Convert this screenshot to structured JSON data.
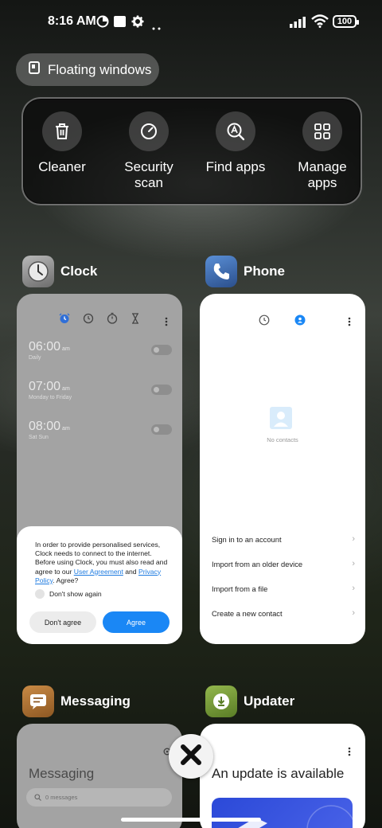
{
  "status": {
    "time": "8:16 AM",
    "battery": "100"
  },
  "floating": {
    "label": "Floating windows"
  },
  "quick_actions": [
    {
      "id": "cleaner",
      "icon": "trash-icon",
      "label": "Cleaner"
    },
    {
      "id": "security",
      "icon": "security-scan-icon",
      "label_line1": "Security",
      "label_line2": "scan"
    },
    {
      "id": "find",
      "icon": "find-apps-icon",
      "label": "Find apps"
    },
    {
      "id": "manage",
      "icon": "grid-icon",
      "label_line1": "Manage",
      "label_line2": "apps"
    }
  ],
  "apps": {
    "clock": {
      "name": "Clock",
      "alarms": [
        {
          "time": "06:00",
          "ampm": "am",
          "sub": "Daily"
        },
        {
          "time": "07:00",
          "ampm": "am",
          "sub": "Monday to Friday"
        },
        {
          "time": "08:00",
          "ampm": "am",
          "sub": "Sat Sun"
        }
      ],
      "dialog": {
        "text_before": "In order to provide personalised services, Clock needs to connect to the internet. Before using Clock, you must also read and agree to our ",
        "link1": "User Agreement",
        "mid": " and ",
        "link2": "Privacy Policy",
        "end": ". Agree?",
        "checkbox": "Don't show again",
        "disagree": "Don't agree",
        "agree": "Agree"
      }
    },
    "phone": {
      "name": "Phone",
      "empty": "No contacts",
      "items": [
        "Sign in to an account",
        "Import from an older device",
        "Import from a file",
        "Create a new contact"
      ]
    },
    "messaging": {
      "name": "Messaging",
      "title": "Messaging",
      "search_placeholder": "0 messages"
    },
    "updater": {
      "name": "Updater",
      "title": "An update is available"
    }
  },
  "colors": {
    "accent": "#1a87f5",
    "clock_icon_bg": "#8a8a8a",
    "phone_icon_bg": "#3e6fb5",
    "messaging_icon_bg": "#b87a3a",
    "updater_icon_bg": "#7ea23e"
  }
}
